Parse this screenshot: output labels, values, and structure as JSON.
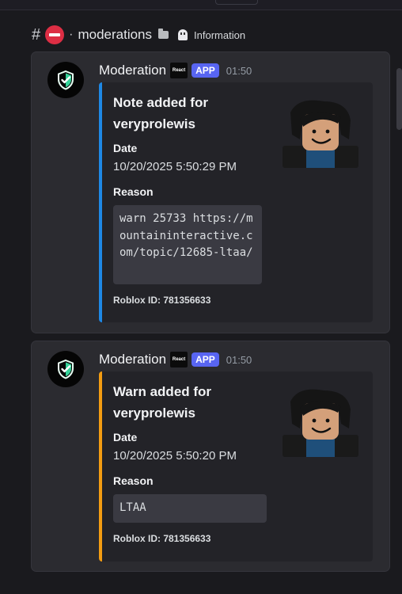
{
  "channel": {
    "name": "moderations",
    "tag": "Information"
  },
  "messages": [
    {
      "author": "Moderation",
      "logo_text": "React",
      "app_badge": "APP",
      "time": "01:50",
      "accent_color": "#1e88e5",
      "embed": {
        "title": "Note added for veryprolewis",
        "date_label": "Date",
        "date_value": "10/20/2025 5:50:29 PM",
        "reason_label": "Reason",
        "reason_value": "warn 25733 https://mountaininteractive.com/topic/12685-ltaa/",
        "footer": "Roblox ID: 781356633"
      }
    },
    {
      "author": "Moderation",
      "logo_text": "React",
      "app_badge": "APP",
      "time": "01:50",
      "accent_color": "#f39c12",
      "embed": {
        "title": "Warn added for veryprolewis",
        "date_label": "Date",
        "date_value": "10/20/2025 5:50:20 PM",
        "reason_label": "Reason",
        "reason_value": "LTAA",
        "footer": "Roblox ID: 781356633"
      }
    }
  ],
  "icons": {
    "avatar": "shield-check-icon",
    "channel_emoji": "no-entry-icon",
    "folder": "folder-icon",
    "ghost": "ghost-icon",
    "thumbnail": "roblox-avatar"
  }
}
